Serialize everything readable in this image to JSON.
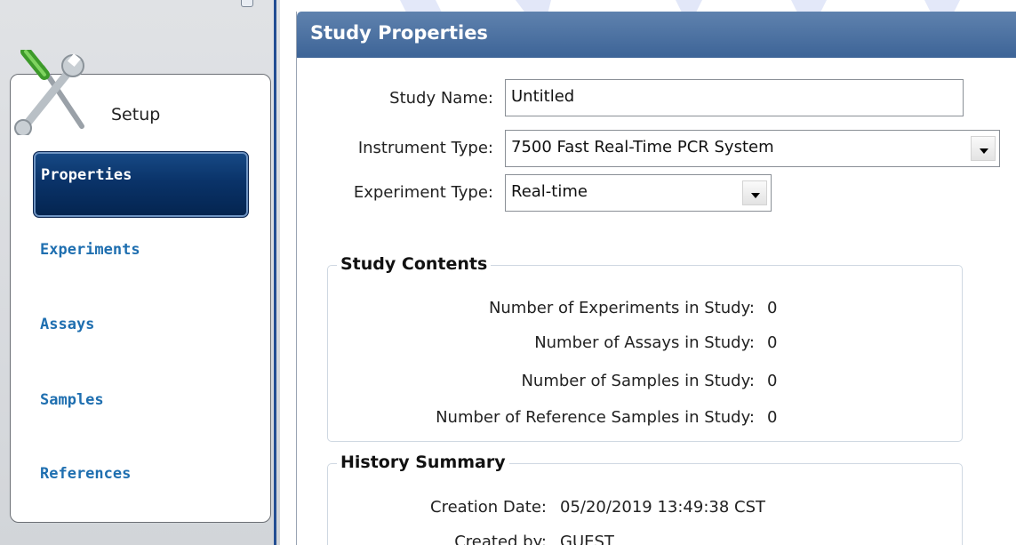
{
  "sidebar": {
    "group_label": "Setup",
    "items": [
      {
        "label": "Properties",
        "active": true
      },
      {
        "label": "Experiments",
        "active": false
      },
      {
        "label": "Assays",
        "active": false
      },
      {
        "label": "Samples",
        "active": false
      },
      {
        "label": "References",
        "active": false
      }
    ]
  },
  "panel": {
    "title": "Study Properties",
    "form": {
      "study_name_label": "Study Name:",
      "study_name_value": "Untitled",
      "instrument_type_label": "Instrument Type:",
      "instrument_type_value": "7500 Fast Real-Time PCR System",
      "experiment_type_label": "Experiment Type:",
      "experiment_type_value": "Real-time"
    },
    "study_contents": {
      "title": "Study Contents",
      "rows": [
        {
          "label": "Number of Experiments in Study:",
          "value": "0"
        },
        {
          "label": "Number of Assays in Study:",
          "value": "0"
        },
        {
          "label": "Number of Samples in Study:",
          "value": "0"
        },
        {
          "label": "Number of Reference Samples in Study:",
          "value": "0"
        }
      ]
    },
    "history_summary": {
      "title": "History Summary",
      "creation_date_label": "Creation Date:",
      "creation_date_value": "05/20/2019 13:49:38 CST",
      "created_by_label": "Created by:",
      "created_by_value": "GUEST"
    }
  },
  "colors": {
    "header_blue": "#3d6497",
    "nav_active": "#0a3369",
    "nav_link": "#1f6fb0",
    "divider": "#234e93"
  }
}
